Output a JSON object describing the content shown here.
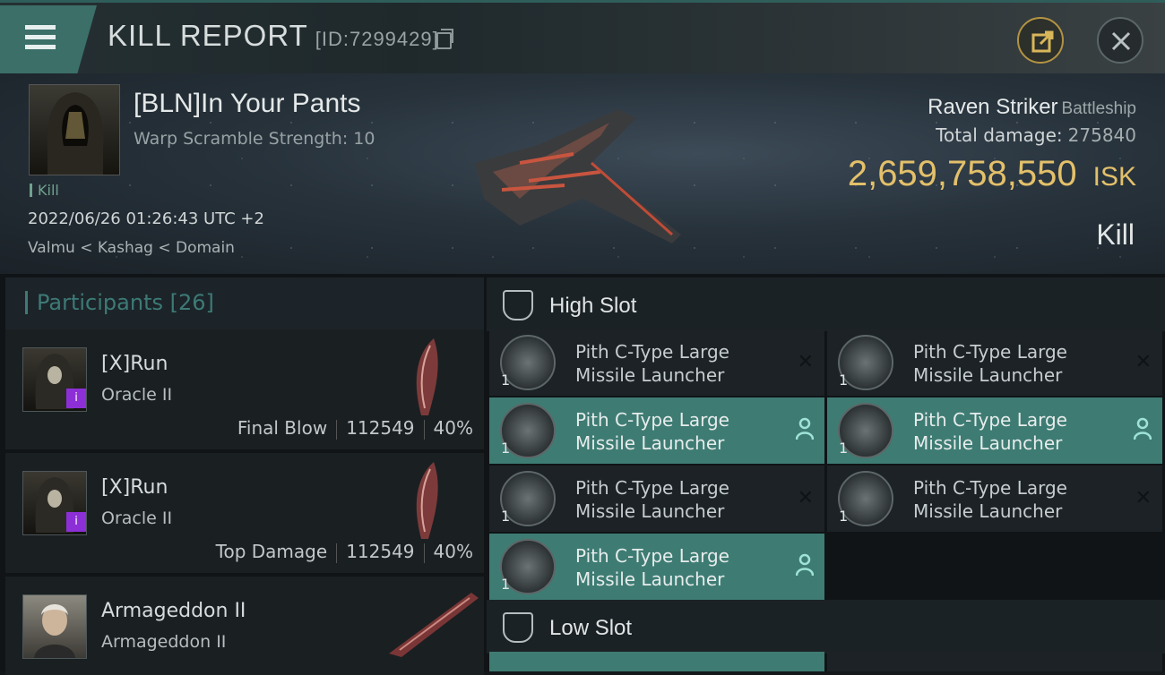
{
  "header": {
    "title": "KILL REPORT",
    "report_id": "[ID:7299429]"
  },
  "victim": {
    "name": "[BLN]In Your Pants",
    "warp_scramble": "Warp Scramble Strength: 10",
    "kill_tag": "Kill",
    "datetime": "2022/06/26 01:26:43 UTC +2",
    "location": "Valmu < Kashag < Domain",
    "ship": "Raven Striker",
    "ship_class": "Battleship",
    "damage_label": "Total damage:",
    "damage_value": "275840",
    "isk_value": "2,659,758,550",
    "isk_unit": "ISK",
    "result": "Kill"
  },
  "participants": {
    "label": "Participants",
    "count": "[26]",
    "items": [
      {
        "name": "[X]Run",
        "ship": "Oracle II",
        "role": "Final Blow",
        "damage": "112549",
        "percent": "40%"
      },
      {
        "name": "[X]Run",
        "ship": "Oracle II",
        "role": "Top Damage",
        "damage": "112549",
        "percent": "40%"
      },
      {
        "name": "Armageddon II",
        "ship": "Armageddon II"
      }
    ]
  },
  "slots": {
    "high_label": "High Slot",
    "low_label": "Low Slot",
    "modules": [
      {
        "line1": "Pith C-Type Large",
        "line2": "Missile Launcher",
        "qty": "1",
        "status": "destroyed"
      },
      {
        "line1": "Pith C-Type Large",
        "line2": "Missile Launcher",
        "qty": "1",
        "status": "destroyed"
      },
      {
        "line1": "Pith C-Type Large",
        "line2": "Missile Launcher",
        "qty": "1",
        "status": "dropped"
      },
      {
        "line1": "Pith C-Type Large",
        "line2": "Missile Launcher",
        "qty": "1",
        "status": "dropped"
      },
      {
        "line1": "Pith C-Type Large",
        "line2": "Missile Launcher",
        "qty": "1",
        "status": "destroyed"
      },
      {
        "line1": "Pith C-Type Large",
        "line2": "Missile Launcher",
        "qty": "1",
        "status": "destroyed"
      },
      {
        "line1": "Pith C-Type Large",
        "line2": "Missile Launcher",
        "qty": "1",
        "status": "dropped"
      }
    ]
  },
  "colors": {
    "accent": "#3e7c73",
    "isk": "#e3c06a",
    "badge": "#8d2fd6"
  }
}
